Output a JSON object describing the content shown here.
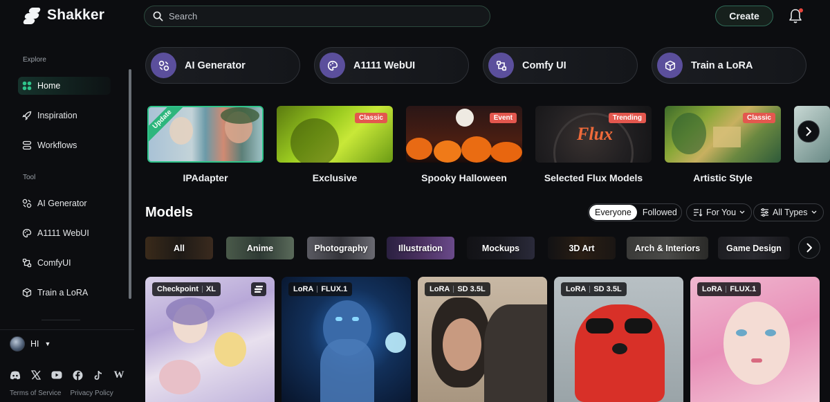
{
  "brand": {
    "name": "Shakker"
  },
  "search": {
    "placeholder": "Search"
  },
  "header": {
    "create_label": "Create"
  },
  "sidebar": {
    "explore_label": "Explore",
    "explore_items": [
      {
        "label": "Home",
        "icon": "grid-icon"
      },
      {
        "label": "Inspiration",
        "icon": "rocket-icon"
      },
      {
        "label": "Workflows",
        "icon": "workflow-icon"
      }
    ],
    "tool_label": "Tool",
    "tool_items": [
      {
        "label": "AI Generator",
        "icon": "ai-generator-icon"
      },
      {
        "label": "A1111 WebUI",
        "icon": "palette-icon"
      },
      {
        "label": "ComfyUI",
        "icon": "comfy-icon"
      },
      {
        "label": "Train a LoRA",
        "icon": "cube-icon"
      }
    ],
    "user_name": "HI",
    "social": [
      "discord-icon",
      "x-icon",
      "youtube-icon",
      "facebook-icon",
      "tiktok-icon",
      "wiki-icon"
    ],
    "footer": {
      "terms": "Terms of Service",
      "privacy": "Privacy Policy"
    }
  },
  "tools": [
    {
      "label": "AI Generator"
    },
    {
      "label": "A1111 WebUI"
    },
    {
      "label": "Comfy UI"
    },
    {
      "label": "Train a LoRA"
    }
  ],
  "featured": [
    {
      "title": "IPAdapter",
      "tag": "Update"
    },
    {
      "title": "Exclusive",
      "tag": "Classic"
    },
    {
      "title": "Spooky Halloween",
      "tag": "Event"
    },
    {
      "title": "Selected Flux Models",
      "tag": "Trending"
    },
    {
      "title": "Artistic Style",
      "tag": "Classic"
    }
  ],
  "models": {
    "title": "Models",
    "filter_everyone": "Everyone",
    "filter_followed": "Followed",
    "sort_label": "For You",
    "type_label": "All Types",
    "categories": [
      "All",
      "Anime",
      "Photography",
      "Illustration",
      "Mockups",
      "3D Art",
      "Arch & Interiors",
      "Game Design"
    ],
    "cards": [
      {
        "type": "Checkpoint",
        "base": "XL"
      },
      {
        "type": "LoRA",
        "base": "FLUX.1"
      },
      {
        "type": "LoRA",
        "base": "SD 3.5L"
      },
      {
        "type": "LoRA",
        "base": "SD 3.5L"
      },
      {
        "type": "LoRA",
        "base": "FLUX.1"
      }
    ]
  },
  "colors": {
    "accent": "#2db67d",
    "tool_circle": "#5b4f9c",
    "tag_red": "#e3574e"
  }
}
